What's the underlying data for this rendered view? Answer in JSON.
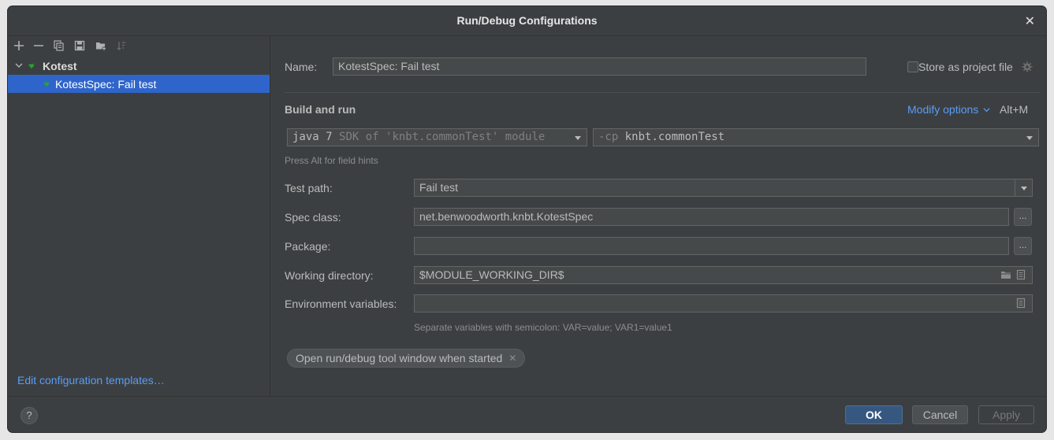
{
  "window": {
    "title": "Run/Debug Configurations",
    "close_glyph": "✕"
  },
  "toolbar": {
    "icons": [
      "add-icon",
      "remove-icon",
      "copy-icon",
      "save-icon",
      "new-folder-icon",
      "sort-icon"
    ],
    "add_glyph": "+",
    "remove_glyph": "−"
  },
  "tree": {
    "group_label": "Kotest",
    "item_label": "KotestSpec: Fail test",
    "accent_color": "#2fbf3a"
  },
  "left_footer": {
    "edit_templates": "Edit configuration templates…"
  },
  "form": {
    "name_label": "Name:",
    "name_value": "KotestSpec: Fail test",
    "store_label": "Store as project file",
    "store_checked": false,
    "build_run_title": "Build and run",
    "modify_options": "Modify options",
    "modify_shortcut": "Alt+M",
    "sdk_main": "java 7",
    "sdk_detail": "SDK of 'knbt.commonTest' module",
    "cp_flag": "-cp",
    "cp_value": "knbt.commonTest",
    "field_hint": "Press Alt for field hints",
    "test_path_label": "Test path:",
    "test_path_value": "Fail test",
    "spec_class_label": "Spec class:",
    "spec_class_value": "net.benwoodworth.knbt.KotestSpec",
    "package_label": "Package:",
    "package_value": "",
    "workdir_label": "Working directory:",
    "workdir_value": "$MODULE_WORKING_DIR$",
    "env_label": "Environment variables:",
    "env_value": "",
    "env_hint": "Separate variables with semicolon: VAR=value; VAR1=value1",
    "chip_label": "Open run/debug tool window when started",
    "dots": "..."
  },
  "footer": {
    "help": "?",
    "ok": "OK",
    "cancel": "Cancel",
    "apply": "Apply"
  },
  "colors": {
    "background": "#3c3f41",
    "field_bg": "#45494a",
    "selection": "#2f65ca",
    "link": "#589df6",
    "primary_button": "#365880"
  }
}
